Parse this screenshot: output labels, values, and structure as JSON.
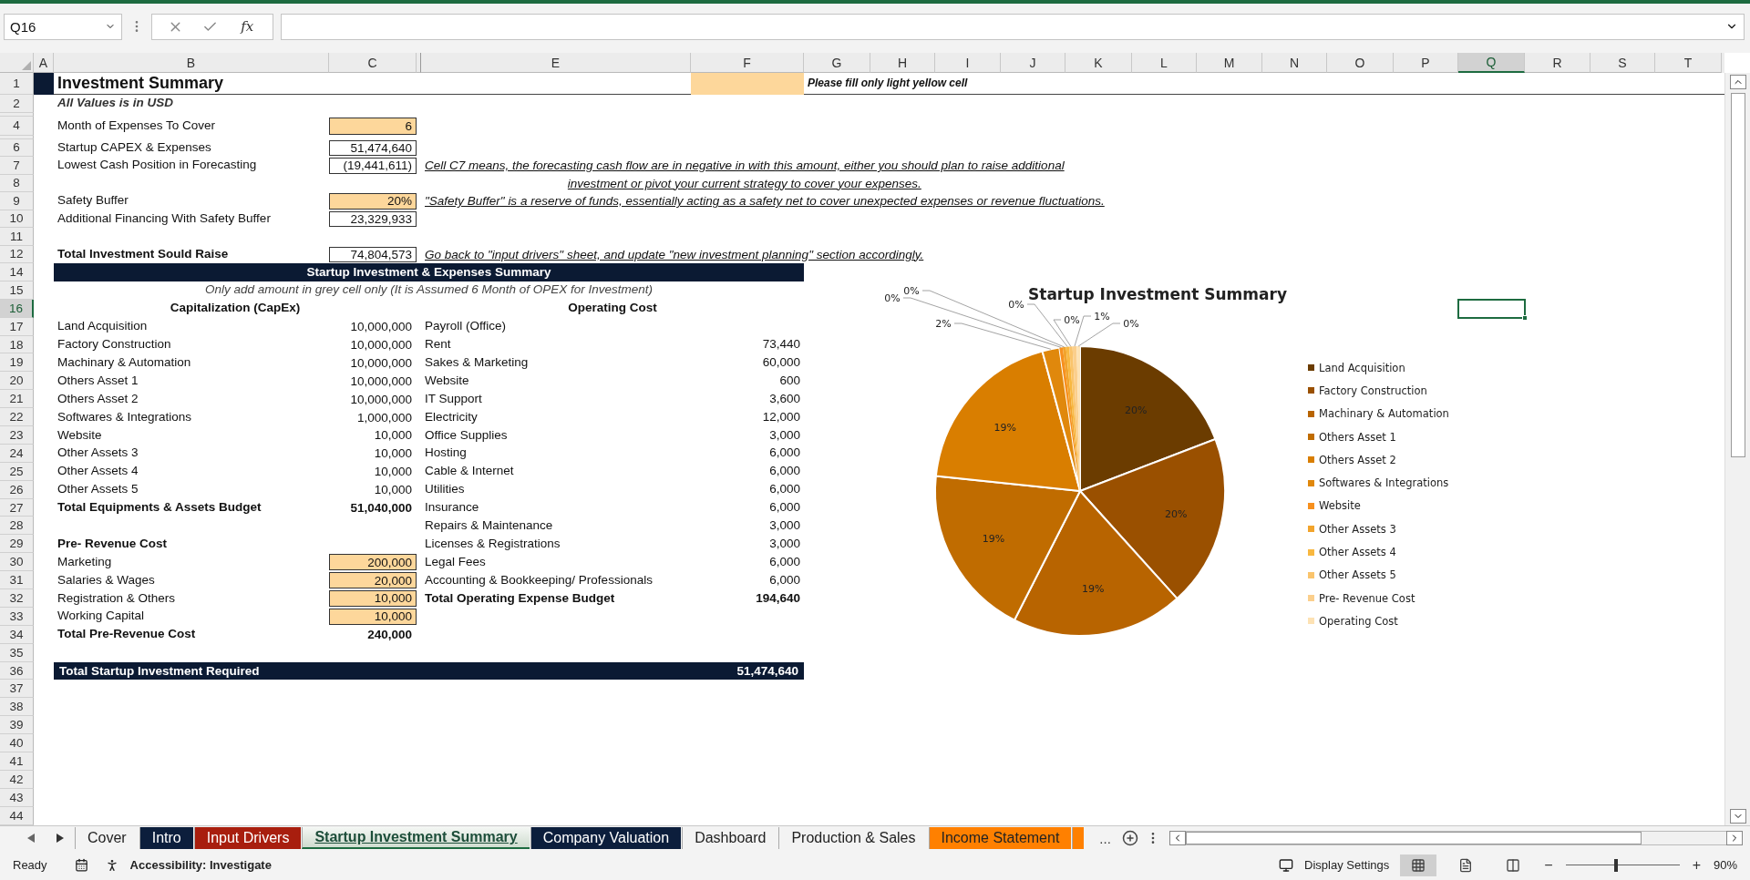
{
  "name_box": {
    "value": "Q16"
  },
  "formula_bar": {
    "function_label": "fx"
  },
  "column_headers": [
    {
      "label": "A",
      "selected": false
    },
    {
      "label": "B",
      "selected": false
    },
    {
      "label": "C",
      "selected": false
    },
    {
      "label": "E",
      "selected": false
    },
    {
      "label": "F",
      "selected": false
    },
    {
      "label": "G",
      "selected": false
    },
    {
      "label": "H",
      "selected": false
    },
    {
      "label": "I",
      "selected": false
    },
    {
      "label": "J",
      "selected": false
    },
    {
      "label": "K",
      "selected": false
    },
    {
      "label": "L",
      "selected": false
    },
    {
      "label": "M",
      "selected": false
    },
    {
      "label": "N",
      "selected": false
    },
    {
      "label": "O",
      "selected": false
    },
    {
      "label": "P",
      "selected": false
    },
    {
      "label": "Q",
      "selected": true
    },
    {
      "label": "R",
      "selected": false
    },
    {
      "label": "S",
      "selected": false
    },
    {
      "label": "T",
      "selected": false
    }
  ],
  "row_headers": [
    {
      "label": "1",
      "selected": false
    },
    {
      "label": "2",
      "selected": false
    },
    {
      "label": "4",
      "selected": false
    },
    {
      "label": "6",
      "selected": false
    },
    {
      "label": "7",
      "selected": false
    },
    {
      "label": "8",
      "selected": false
    },
    {
      "label": "9",
      "selected": false
    },
    {
      "label": "10",
      "selected": false
    },
    {
      "label": "11",
      "selected": false
    },
    {
      "label": "12",
      "selected": false
    },
    {
      "label": "14",
      "selected": false
    },
    {
      "label": "15",
      "selected": false
    },
    {
      "label": "16",
      "selected": true
    },
    {
      "label": "17",
      "selected": false
    },
    {
      "label": "18",
      "selected": false
    },
    {
      "label": "19",
      "selected": false
    },
    {
      "label": "20",
      "selected": false
    },
    {
      "label": "21",
      "selected": false
    },
    {
      "label": "22",
      "selected": false
    },
    {
      "label": "23",
      "selected": false
    },
    {
      "label": "24",
      "selected": false
    },
    {
      "label": "25",
      "selected": false
    },
    {
      "label": "26",
      "selected": false
    },
    {
      "label": "27",
      "selected": false
    },
    {
      "label": "28",
      "selected": false
    },
    {
      "label": "29",
      "selected": false
    },
    {
      "label": "30",
      "selected": false
    },
    {
      "label": "31",
      "selected": false
    },
    {
      "label": "32",
      "selected": false
    },
    {
      "label": "33",
      "selected": false
    },
    {
      "label": "34",
      "selected": false
    },
    {
      "label": "35",
      "selected": false
    },
    {
      "label": "36",
      "selected": false
    },
    {
      "label": "37",
      "selected": false
    },
    {
      "label": "38",
      "selected": false
    },
    {
      "label": "39",
      "selected": false
    },
    {
      "label": "40",
      "selected": false
    },
    {
      "label": "41",
      "selected": false
    },
    {
      "label": "42",
      "selected": false
    },
    {
      "label": "43",
      "selected": false
    },
    {
      "label": "44",
      "selected": false
    }
  ],
  "sheet": {
    "title": "Investment Summary",
    "fill_note": "Please fill only light yellow cell",
    "subtitle": "All Values is in USD",
    "key_figures": [
      {
        "label": "Month of Expenses To Cover",
        "value": "6",
        "input": true,
        "total": false
      },
      {
        "label": "Startup CAPEX & Expenses",
        "value": "51,474,640",
        "input": false,
        "total": false
      },
      {
        "label": "Lowest Cash Position in Forecasting",
        "value": "(19,441,611)",
        "input": false,
        "total": false,
        "notes": [
          "Cell C7 means, the forecasting cash flow are in negative in with this amount, either you should plan to raise additional",
          "investment or pivot your current strategy to cover your expenses."
        ]
      },
      {
        "label": "Safety Buffer",
        "value": "20%",
        "input": true,
        "total": false,
        "notes": [
          "\"Safety Buffer\" is a reserve of funds, essentially acting as a safety net to cover unexpected expenses or revenue fluctuations."
        ]
      },
      {
        "label": "Additional Financing With Safety Buffer",
        "value": "23,329,933",
        "input": false,
        "total": false
      },
      {
        "label": "Total Investment Sould Raise",
        "value": "74,804,573",
        "input": false,
        "total": true,
        "notes": [
          "Go back to \"input drivers\" sheet, and update \"new investment planning\" section accordingly."
        ]
      }
    ],
    "summary": {
      "heading": "Startup Investment & Expenses Summary",
      "instruction": "Only add amount in grey cell only (It is Assumed 6 Month of OPEX for Investment)",
      "capex": {
        "heading": "Capitalization (CapEx)",
        "items": [
          {
            "label": "Land Acquisition",
            "value": "10,000,000",
            "input": false
          },
          {
            "label": "Factory Construction",
            "value": "10,000,000",
            "input": false
          },
          {
            "label": "Machinary & Automation",
            "value": "10,000,000",
            "input": false
          },
          {
            "label": "Others Asset 1",
            "value": "10,000,000",
            "input": false
          },
          {
            "label": "Others Asset 2",
            "value": "10,000,000",
            "input": false
          },
          {
            "label": "Softwares & Integrations",
            "value": "1,000,000",
            "input": false
          },
          {
            "label": "Website",
            "value": "10,000",
            "input": false
          },
          {
            "label": "Other Assets 3",
            "value": "10,000",
            "input": false
          },
          {
            "label": "Other Assets 4",
            "value": "10,000",
            "input": false
          },
          {
            "label": "Other Assets 5",
            "value": "10,000",
            "input": false
          }
        ],
        "total": {
          "label": "Total Equipments & Assets Budget",
          "value": "51,040,000"
        }
      },
      "pre_revenue": {
        "heading": "Pre- Revenue Cost",
        "items": [
          {
            "label": "Marketing",
            "value": "200,000",
            "input": true
          },
          {
            "label": "Salaries & Wages",
            "value": "20,000",
            "input": true
          },
          {
            "label": "Registration & Others",
            "value": "10,000",
            "input": true
          },
          {
            "label": "Working Capital",
            "value": "10,000",
            "input": true
          }
        ],
        "total": {
          "label": "Total Pre-Revenue Cost",
          "value": "240,000"
        }
      },
      "opex": {
        "heading": "Operating Cost",
        "items": [
          {
            "label": "Payroll (Office)"
          },
          {
            "label": "Rent",
            "value": "73,440"
          },
          {
            "label": "Sakes & Marketing",
            "value": "60,000"
          },
          {
            "label": "Website",
            "value": "600"
          },
          {
            "label": "IT Support",
            "value": "3,600"
          },
          {
            "label": "Electricity",
            "value": "12,000"
          },
          {
            "label": "Office Supplies",
            "value": "3,000"
          },
          {
            "label": "Hosting",
            "value": "6,000"
          },
          {
            "label": "Cable & Internet",
            "value": "6,000"
          },
          {
            "label": "Utilities",
            "value": "6,000"
          },
          {
            "label": "Insurance",
            "value": "6,000"
          },
          {
            "label": "Repairs & Maintenance",
            "value": "3,000"
          },
          {
            "label": "Licenses & Registrations",
            "value": "3,000"
          },
          {
            "label": "Legal Fees",
            "value": "6,000"
          },
          {
            "label": "Accounting & Bookkeeping/ Professionals",
            "value": "6,000"
          }
        ],
        "total": {
          "label": "Total Operating Expense Budget",
          "value": "194,640"
        }
      },
      "grand_total": {
        "label": "Total Startup Investment Required",
        "value": "51,474,640"
      }
    }
  },
  "chart": {
    "chart_data": {
      "type": "pie",
      "title": "Startup Investment Summary",
      "categories": [
        "Land Acquisition",
        "Factory Construction",
        "Machinary & Automation",
        "Others Asset 1",
        "Others Asset 2",
        "Softwares & Integrations",
        "Website",
        "Other Assets 3",
        "Other Assets 4",
        "Other Assets 5",
        "Pre- Revenue Cost",
        "Operating Cost"
      ],
      "series": [
        {
          "values": [
            19.43,
            19.43,
            19.43,
            19.43,
            19.43,
            1.94,
            0.02,
            0.02,
            0.02,
            0.02,
            0.47,
            0.38
          ],
          "colors": [
            "#6b3c00",
            "#9a5000",
            "#b86400",
            "#c06c00",
            "#d97e00",
            "#e0880c",
            "#f7901e",
            "#f2a42c",
            "#f8b840",
            "#fac46c",
            "#fbcf8c",
            "#fde2b4"
          ]
        }
      ],
      "value_labels": [
        "20%",
        "20%",
        "19%",
        "19%",
        "19%",
        "2%",
        "0%",
        "0%",
        "0%",
        "0%",
        "1%",
        "0%"
      ],
      "legend": true
    }
  },
  "sheet_tabs": [
    {
      "label": "Cover",
      "selected": false
    },
    {
      "label": "Intro",
      "selected": false,
      "color": "#0c1e3c"
    },
    {
      "label": "Input Drivers",
      "selected": false,
      "color": "#a81e0e"
    },
    {
      "label": "Startup Investment Summary",
      "selected": true
    },
    {
      "label": "Company Valuation",
      "selected": false,
      "color": "#0c1e3c"
    },
    {
      "label": "Dashboard",
      "selected": false
    },
    {
      "label": "Production & Sales",
      "selected": false
    },
    {
      "label": "Income Statement",
      "selected": false,
      "color": "#ff8000"
    },
    {
      "selected": false,
      "color": "#ff8000"
    }
  ],
  "more_tabs": "...",
  "status_bar": {
    "mode": "Ready",
    "accessibility": "Accessibility: Investigate",
    "display_settings": "Display Settings",
    "views": [
      {
        "kind": "normal",
        "selected": true
      },
      {
        "kind": "page_layout",
        "selected": false
      },
      {
        "kind": "page_break",
        "selected": false
      }
    ],
    "zoom": {
      "minus": "−",
      "plus": "+",
      "level": 0.44,
      "reading": "90%"
    }
  }
}
